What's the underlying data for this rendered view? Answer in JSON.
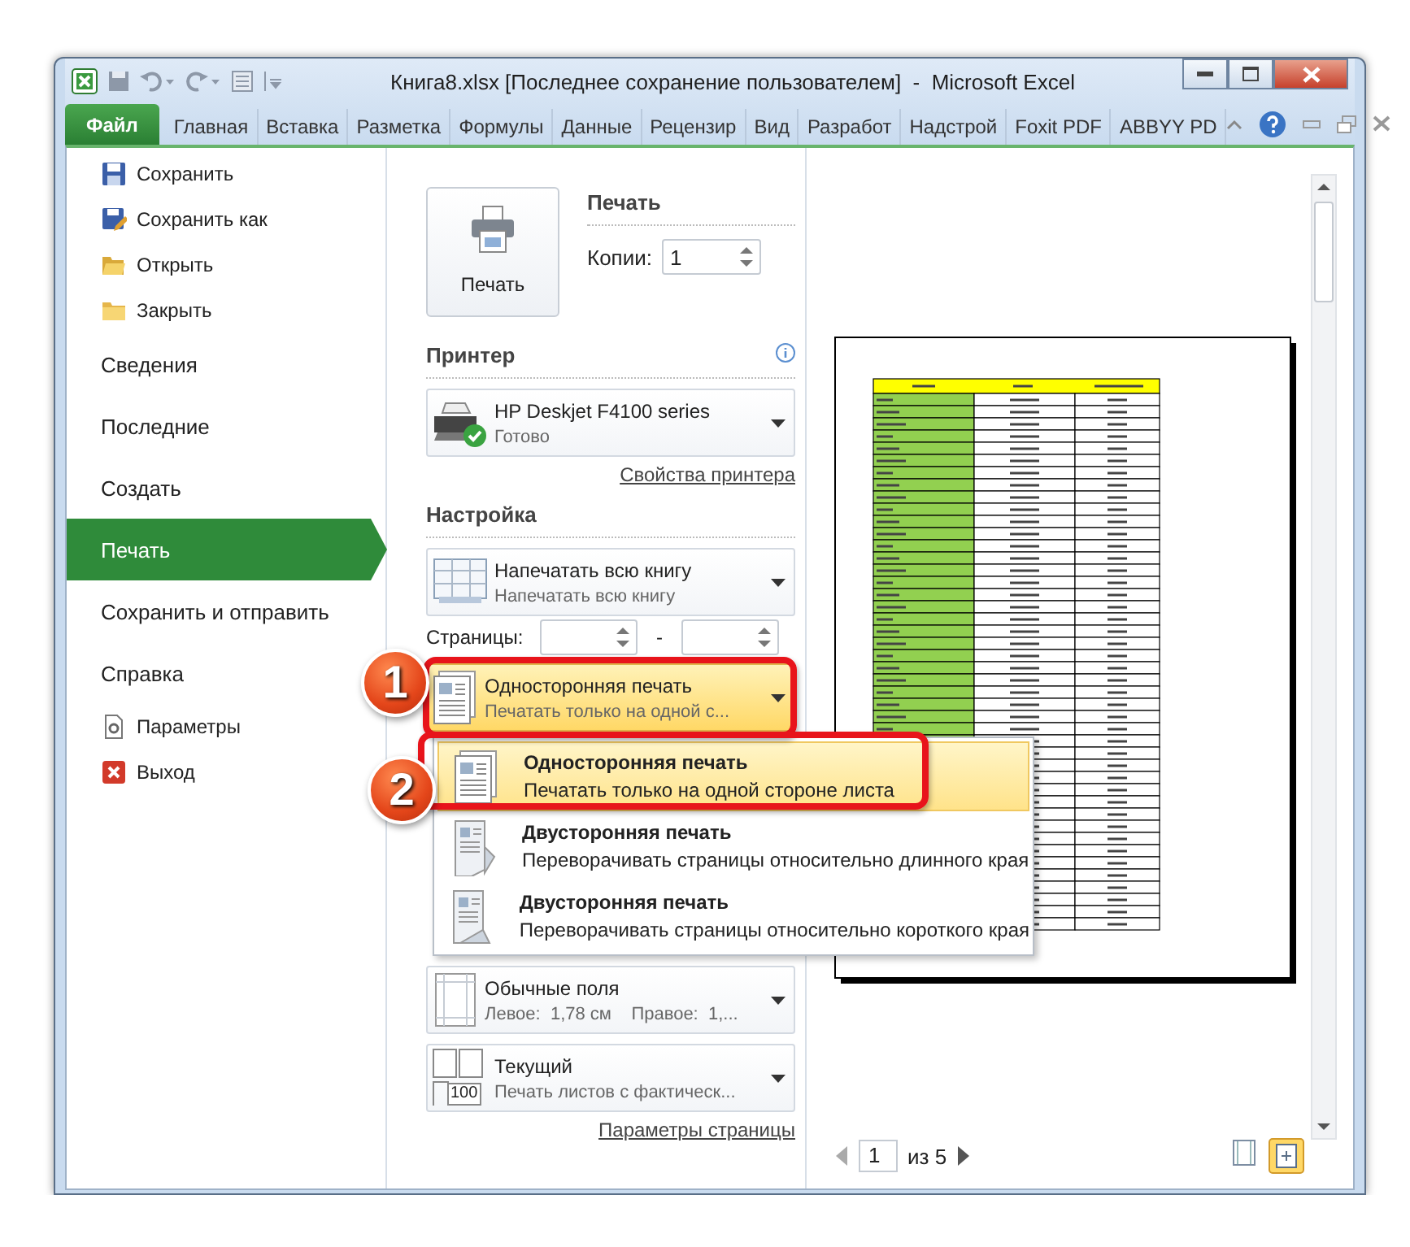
{
  "window": {
    "title": "Книга8.xlsx [Последнее сохранение пользователем]  -  Microsoft Excel"
  },
  "ribbon_tabs": [
    {
      "label": "Файл",
      "selected": true
    },
    {
      "label": "Главная",
      "selected": false
    },
    {
      "label": "Вставка",
      "selected": false
    },
    {
      "label": "Разметка",
      "selected": false
    },
    {
      "label": "Формулы",
      "selected": false
    },
    {
      "label": "Данные",
      "selected": false
    },
    {
      "label": "Рецензир",
      "selected": false
    },
    {
      "label": "Вид",
      "selected": false
    },
    {
      "label": "Разработ",
      "selected": false
    },
    {
      "label": "Надстрой",
      "selected": false
    },
    {
      "label": "Foxit PDF",
      "selected": false
    },
    {
      "label": "ABBYY PD",
      "selected": false
    }
  ],
  "nav": {
    "items": [
      {
        "label": "Сохранить",
        "kind": "command",
        "selected": false
      },
      {
        "label": "Сохранить как",
        "kind": "command",
        "selected": false
      },
      {
        "label": "Открыть",
        "kind": "command",
        "selected": false
      },
      {
        "label": "Закрыть",
        "kind": "command",
        "selected": false
      },
      {
        "label": "Сведения",
        "kind": "section",
        "selected": false
      },
      {
        "label": "Последние",
        "kind": "section",
        "selected": false
      },
      {
        "label": "Создать",
        "kind": "section",
        "selected": false
      },
      {
        "label": "Печать",
        "kind": "section",
        "selected": true
      },
      {
        "label": "Сохранить и отправить",
        "kind": "section",
        "selected": false
      },
      {
        "label": "Справка",
        "kind": "section",
        "selected": false
      },
      {
        "label": "Параметры",
        "kind": "command",
        "selected": false
      },
      {
        "label": "Выход",
        "kind": "command",
        "selected": false
      }
    ]
  },
  "print": {
    "button_label": "Печать",
    "heading": "Печать",
    "copies_label": "Копии:",
    "copies_value": "1"
  },
  "printer": {
    "heading": "Принтер",
    "name": "HP Deskjet F4100 series",
    "status": "Готово",
    "properties_link": "Свойства принтера"
  },
  "settings": {
    "heading": "Настройка",
    "what": {
      "title": "Напечатать всю книгу",
      "subtitle": "Напечатать всю книгу",
      "active": false
    },
    "pages_label": "Страницы:",
    "pages_separator": "-",
    "sides": {
      "title": "Односторонняя печать",
      "subtitle": "Печатать только на одной с...",
      "active": true
    },
    "margins": {
      "title": "Обычные поля",
      "subtitle": "Левое:  1,78 см    Правое:  1,...",
      "active": false
    },
    "scaling": {
      "title": "Текущий",
      "subtitle": "Печать листов с фактическ...",
      "active": false,
      "badge": "100"
    },
    "page_setup_link": "Параметры страницы"
  },
  "menu": {
    "items": [
      {
        "title": "Односторонняя печать",
        "subtitle": "Печатать только на одной стороне листа",
        "selected": true
      },
      {
        "title": "Двусторонняя печать",
        "subtitle": "Переворачивать страницы относительно длинного края",
        "selected": false
      },
      {
        "title": "Двусторонняя печать",
        "subtitle": "Переворачивать страницы относительно короткого края",
        "selected": false
      }
    ]
  },
  "callouts": [
    {
      "number": "1"
    },
    {
      "number": "2"
    }
  ],
  "preview": {
    "page_value": "1",
    "page_total": "из 5"
  }
}
